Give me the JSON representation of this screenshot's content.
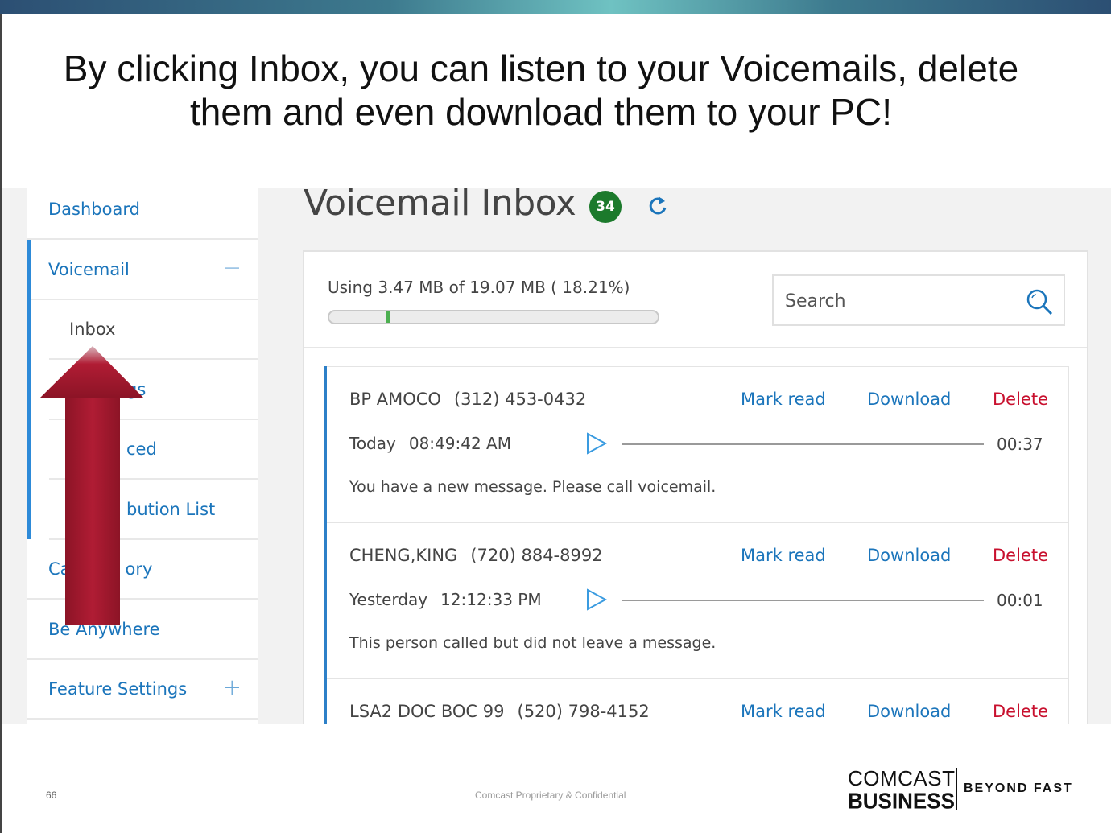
{
  "slide": {
    "title": "By clicking Inbox, you can listen to your Voicemails, delete them and even download them to your PC!",
    "page_number": "66",
    "footer_note": "Comcast Proprietary & Confidential"
  },
  "brand": {
    "line1": "COMCAST",
    "line2": "BUSINESS",
    "tagline": "BEYOND FAST"
  },
  "sidebar": {
    "items": [
      {
        "label": "Dashboard"
      },
      {
        "label": "Voicemail",
        "toggle": "−"
      },
      {
        "label": "Inbox"
      },
      {
        "label": "gs"
      },
      {
        "label": "ced"
      },
      {
        "label": "bution List"
      },
      {
        "label": "Ca",
        "label2": "ory"
      },
      {
        "label": "Be Anywhere"
      },
      {
        "label": "Feature Settings",
        "toggle": "+"
      }
    ]
  },
  "main": {
    "title": "Voicemail Inbox",
    "count": "34",
    "usage_text": "Using 3.47 MB of 19.07 MB ( 18.21%)",
    "usage_fraction": 0.1821,
    "search_placeholder": "Search"
  },
  "voicemails": [
    {
      "caller": "BP AMOCO",
      "number": "(312) 453-0432",
      "day": "Today",
      "time": "08:49:42 AM",
      "duration": "00:37",
      "message": "You have a new message. Please call voicemail.",
      "mark_read": "Mark read",
      "download": "Download",
      "delete": "Delete"
    },
    {
      "caller": "CHENG,KING",
      "number": "(720) 884-8992",
      "day": "Yesterday",
      "time": "12:12:33 PM",
      "duration": "00:01",
      "message": "This person called but did not leave a message.",
      "mark_read": "Mark read",
      "download": "Download",
      "delete": "Delete"
    },
    {
      "caller": "LSA2 DOC BOC 99",
      "number": "(520) 798-4152",
      "day": "",
      "time": "",
      "duration": "",
      "message": "",
      "mark_read": "Mark read",
      "download": "Download",
      "delete": "Delete"
    }
  ],
  "colors": {
    "accent": "#1b75bb",
    "delete": "#c8102e",
    "badge": "#1c7a2c",
    "arrow": "#a31830"
  }
}
